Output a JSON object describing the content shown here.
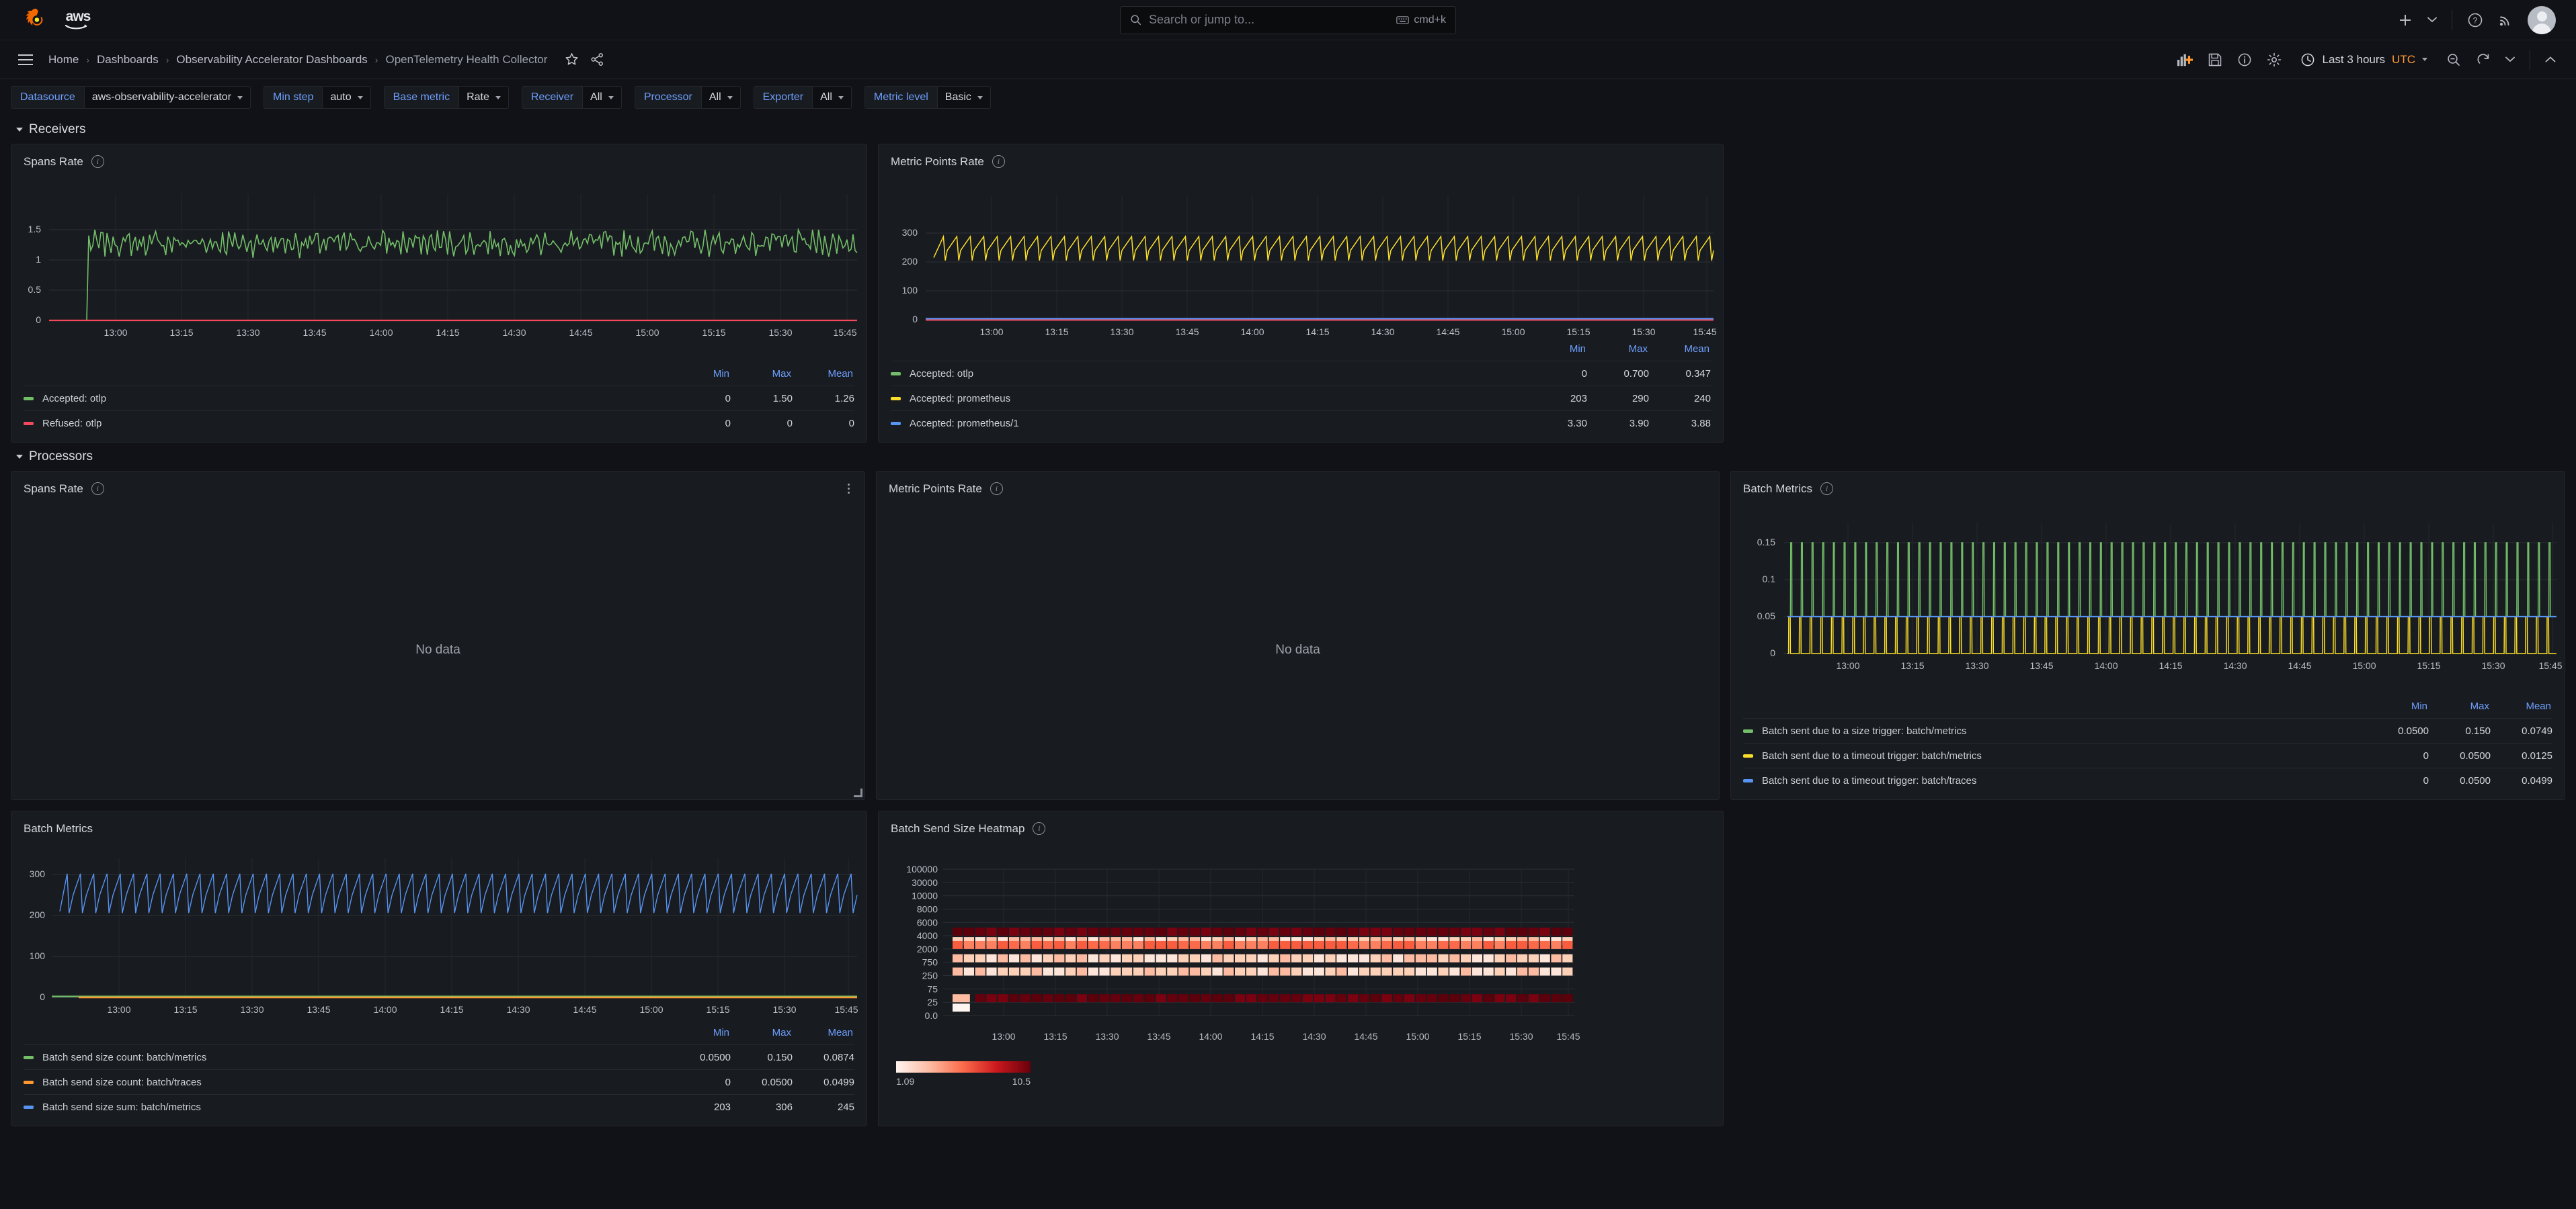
{
  "topbar": {
    "brand_aws": "aws",
    "search_placeholder": "Search or jump to...",
    "shortcut": "cmd+k",
    "icons": [
      "plus-icon",
      "chevron-down-icon",
      "help-icon",
      "news-icon",
      "avatar"
    ]
  },
  "navbar": {
    "breadcrumbs": [
      {
        "label": "Home"
      },
      {
        "label": "Dashboards"
      },
      {
        "label": "Observability Accelerator Dashboards"
      },
      {
        "label": "OpenTelemetry Health Collector"
      }
    ],
    "separator": "›",
    "star_icon": "star-icon",
    "share_icon": "share-icon",
    "time_range": "Last 3 hours",
    "timezone": "UTC"
  },
  "variables": [
    {
      "label": "Datasource",
      "value": "aws-observability-accelerator"
    },
    {
      "label": "Min step",
      "value": "auto"
    },
    {
      "label": "Base metric",
      "value": "Rate"
    },
    {
      "label": "Receiver",
      "value": "All"
    },
    {
      "label": "Processor",
      "value": "All"
    },
    {
      "label": "Exporter",
      "value": "All"
    },
    {
      "label": "Metric level",
      "value": "Basic"
    }
  ],
  "rows": [
    {
      "title": "Receivers"
    },
    {
      "title": "Processors"
    }
  ],
  "legend_headers": [
    "Min",
    "Max",
    "Mean"
  ],
  "no_data_text": "No data",
  "colors": {
    "green": "#73bf69",
    "red": "#f2495c",
    "yellow": "#fade2a",
    "blue": "#5794f2",
    "orange": "#ff9830",
    "accent_blue": "#6e9fff",
    "utc_orange": "#ff9830"
  },
  "panels": {
    "receivers_spans_rate": {
      "title": "Spans Rate",
      "series": [
        {
          "name": "Accepted: otlp",
          "color": "#73bf69",
          "min": "0",
          "max": "1.50",
          "mean": "1.26"
        },
        {
          "name": "Refused: otlp",
          "color": "#f2495c",
          "min": "0",
          "max": "0",
          "mean": "0"
        }
      ]
    },
    "receivers_metric_points_rate": {
      "title": "Metric Points Rate",
      "series": [
        {
          "name": "Accepted: otlp",
          "color": "#73bf69",
          "min": "0",
          "max": "0.700",
          "mean": "0.347"
        },
        {
          "name": "Accepted: prometheus",
          "color": "#fade2a",
          "min": "203",
          "max": "290",
          "mean": "240"
        },
        {
          "name": "Accepted: prometheus/1",
          "color": "#5794f2",
          "min": "3.30",
          "max": "3.90",
          "mean": "3.88"
        }
      ]
    },
    "processors_spans_rate": {
      "title": "Spans Rate"
    },
    "processors_metric_points_rate": {
      "title": "Metric Points Rate"
    },
    "processors_batch_metrics": {
      "title": "Batch Metrics",
      "series": [
        {
          "name": "Batch sent due to a size trigger: batch/metrics",
          "color": "#73bf69",
          "min": "0.0500",
          "max": "0.150",
          "mean": "0.0749"
        },
        {
          "name": "Batch sent due to a timeout trigger: batch/metrics",
          "color": "#fade2a",
          "min": "0",
          "max": "0.0500",
          "mean": "0.0125"
        },
        {
          "name": "Batch sent due to a timeout trigger: batch/traces",
          "color": "#5794f2",
          "min": "0",
          "max": "0.0500",
          "mean": "0.0499"
        }
      ]
    },
    "batch_metrics_bottom": {
      "title": "Batch Metrics",
      "series": [
        {
          "name": "Batch send size count: batch/metrics",
          "color": "#73bf69",
          "min": "0.0500",
          "max": "0.150",
          "mean": "0.0874"
        },
        {
          "name": "Batch send size count: batch/traces",
          "color": "#fade2a",
          "min": "0",
          "max": "0.0500",
          "mean": "0.0499"
        },
        {
          "name": "Batch send size sum: batch/metrics",
          "color": "#5794f2",
          "min": "203",
          "max": "306",
          "mean": "245"
        }
      ]
    },
    "batch_send_size_heatmap": {
      "title": "Batch Send Size Heatmap",
      "legend_min": "1.09",
      "legend_max": "10.5"
    }
  },
  "chart_data": [
    {
      "type": "line",
      "id": "receivers_spans_rate",
      "title": "Spans Rate",
      "xlabel": "",
      "ylabel": "",
      "ylim": [
        0,
        1.5
      ],
      "yticks": [
        "0",
        "0.5",
        "1",
        "1.5"
      ],
      "xticks": [
        "13:00",
        "13:15",
        "13:30",
        "13:45",
        "14:00",
        "14:15",
        "14:30",
        "14:45",
        "15:00",
        "15:15",
        "15:30",
        "15:45"
      ],
      "grid": true,
      "legend_position": "bottom-table",
      "series": [
        {
          "name": "Accepted: otlp",
          "color": "#73bf69",
          "min": 0,
          "max": 1.5,
          "mean": 1.26,
          "shape": "noisy-band",
          "band": [
            1.05,
            1.5
          ]
        },
        {
          "name": "Refused: otlp",
          "color": "#f2495c",
          "min": 0,
          "max": 0,
          "mean": 0,
          "shape": "flat",
          "value": 0
        }
      ]
    },
    {
      "type": "line",
      "id": "receivers_metric_points_rate",
      "title": "Metric Points Rate",
      "ylim": [
        0,
        300
      ],
      "yticks": [
        "0",
        "100",
        "200",
        "300"
      ],
      "xticks": [
        "13:00",
        "13:15",
        "13:30",
        "13:45",
        "14:00",
        "14:15",
        "14:30",
        "14:45",
        "15:00",
        "15:15",
        "15:30",
        "15:45"
      ],
      "grid": true,
      "legend_position": "bottom-table",
      "series": [
        {
          "name": "Accepted: otlp",
          "color": "#73bf69",
          "min": 0,
          "max": 0.7,
          "mean": 0.347,
          "shape": "flat",
          "value": 0.5
        },
        {
          "name": "Accepted: prometheus",
          "color": "#fade2a",
          "min": 203,
          "max": 290,
          "mean": 240,
          "shape": "sawtooth",
          "band": [
            205,
            290
          ]
        },
        {
          "name": "Accepted: prometheus/1",
          "color": "#5794f2",
          "min": 3.3,
          "max": 3.9,
          "mean": 3.88,
          "shape": "flat",
          "value": 3.88
        }
      ]
    },
    {
      "type": "line",
      "id": "processors_batch_metrics",
      "title": "Batch Metrics",
      "ylim": [
        0,
        0.15
      ],
      "yticks": [
        "0",
        "0.05",
        "0.1",
        "0.15"
      ],
      "xticks": [
        "13:00",
        "13:15",
        "13:30",
        "13:45",
        "14:00",
        "14:15",
        "14:30",
        "14:45",
        "15:00",
        "15:15",
        "15:30",
        "15:45"
      ],
      "grid": true,
      "legend_position": "bottom-table",
      "series": [
        {
          "name": "Batch sent due to a size trigger: batch/metrics",
          "color": "#73bf69",
          "min": 0.05,
          "max": 0.15,
          "mean": 0.0749,
          "shape": "square-pulse",
          "band": [
            0.05,
            0.15
          ]
        },
        {
          "name": "Batch sent due to a timeout trigger: batch/metrics",
          "color": "#fade2a",
          "min": 0,
          "max": 0.05,
          "mean": 0.0125,
          "shape": "square-pulse",
          "band": [
            0,
            0.05
          ]
        },
        {
          "name": "Batch sent due to a timeout trigger: batch/traces",
          "color": "#5794f2",
          "min": 0,
          "max": 0.05,
          "mean": 0.0499,
          "shape": "flat",
          "value": 0.05
        }
      ]
    },
    {
      "type": "line",
      "id": "batch_metrics_bottom",
      "title": "Batch Metrics",
      "ylim": [
        0,
        330
      ],
      "yticks": [
        "0",
        "100",
        "200",
        "300"
      ],
      "xticks": [
        "13:00",
        "13:15",
        "13:30",
        "13:45",
        "14:00",
        "14:15",
        "14:30",
        "14:45",
        "15:00",
        "15:15",
        "15:30",
        "15:45"
      ],
      "grid": true,
      "legend_position": "bottom-table",
      "series": [
        {
          "name": "Batch send size count: batch/metrics",
          "color": "#73bf69",
          "min": 0.05,
          "max": 0.15,
          "mean": 0.0874,
          "shape": "flat",
          "value": 0.1
        },
        {
          "name": "Batch send size count: batch/traces",
          "color": "#ff9830",
          "min": 0,
          "max": 0.05,
          "mean": 0.0499,
          "shape": "flat",
          "value": 0.05
        },
        {
          "name": "Batch send size sum: batch/metrics",
          "color": "#5794f2",
          "min": 203,
          "max": 306,
          "mean": 245,
          "shape": "sawtooth",
          "band": [
            205,
            303
          ]
        }
      ]
    },
    {
      "type": "heatmap",
      "id": "batch_send_size_heatmap",
      "title": "Batch Send Size Heatmap",
      "ybuckets": [
        "0.0",
        "25",
        "75",
        "250",
        "750",
        "2000",
        "4000",
        "6000",
        "8000",
        "10000",
        "30000",
        "100000"
      ],
      "xticks": [
        "13:00",
        "13:15",
        "13:30",
        "13:45",
        "14:00",
        "14:15",
        "14:30",
        "14:45",
        "15:00",
        "15:15",
        "15:30",
        "15:45"
      ],
      "color_scale_min": "1.09",
      "color_scale_max": "10.5",
      "color_ramp": [
        "#fff5f0",
        "#fcbba1",
        "#fb6a4a",
        "#cb181d",
        "#67000d"
      ],
      "rows": [
        {
          "bucket": "25",
          "intensity": 9.8,
          "note": "dark red band, starts after first column"
        },
        {
          "bucket": "250",
          "intensity": 2.2
        },
        {
          "bucket": "750",
          "intensity": 2.0
        },
        {
          "bucket": "2000",
          "intensity": 5.2
        },
        {
          "bucket": "4000",
          "intensity": 2.6
        },
        {
          "bucket": "6000",
          "intensity": 10.2,
          "note": "darkest band at top of 4000-6000 bucket"
        }
      ]
    }
  ]
}
